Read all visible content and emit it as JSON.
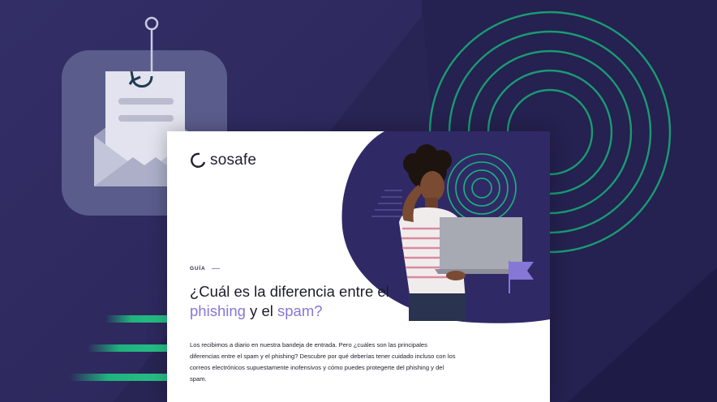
{
  "brand": {
    "logo_text": "sosafe"
  },
  "guide": {
    "tag": "GUÍA",
    "title_start": "¿Cuál es la diferencia entre el ",
    "title_highlight_1": "phishing",
    "title_middle": " y el ",
    "title_highlight_2": "spam",
    "title_end": "?",
    "body": "Los recibimos a diario en nuestra bandeja de entrada. Pero ¿cuáles son las principales diferencias entre el spam y el phishing? Descubre por qué deberías tener cuidado incluso con los correos electrónicos supuestamente inofensivos y cómo puedes protegerte del phishing y del spam."
  },
  "colors": {
    "background": "#282453",
    "panel_light": "#302c60",
    "accent_green": "#1fb27d",
    "accent_purple": "#8577d6",
    "tile": "#5a5c8c"
  },
  "icons": [
    "fishing-hook-icon",
    "envelope-icon",
    "sosafe-logo-icon",
    "flag-icon"
  ]
}
